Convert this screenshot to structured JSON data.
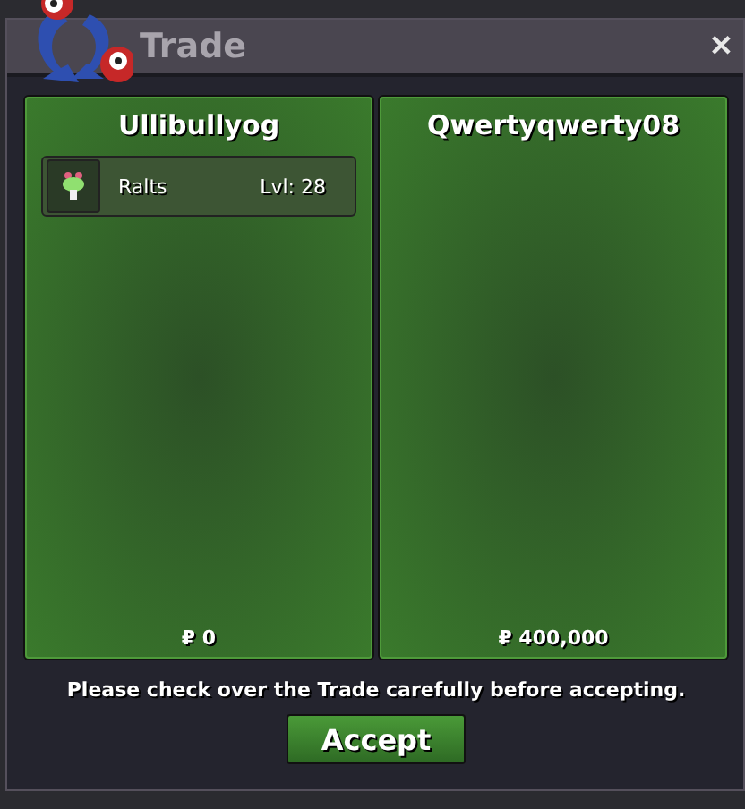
{
  "window": {
    "title": "Trade",
    "close": "✕"
  },
  "panels": [
    {
      "player": "Ullibullyog",
      "items": [
        {
          "name": "Ralts",
          "level": "Lvl: 28"
        }
      ],
      "money": "₽ 0"
    },
    {
      "player": "Qwertyqwerty08",
      "money": "₽ 400,000"
    }
  ],
  "message": "Please check over the Trade carefully before accepting.",
  "buttons": [
    "Accept"
  ]
}
